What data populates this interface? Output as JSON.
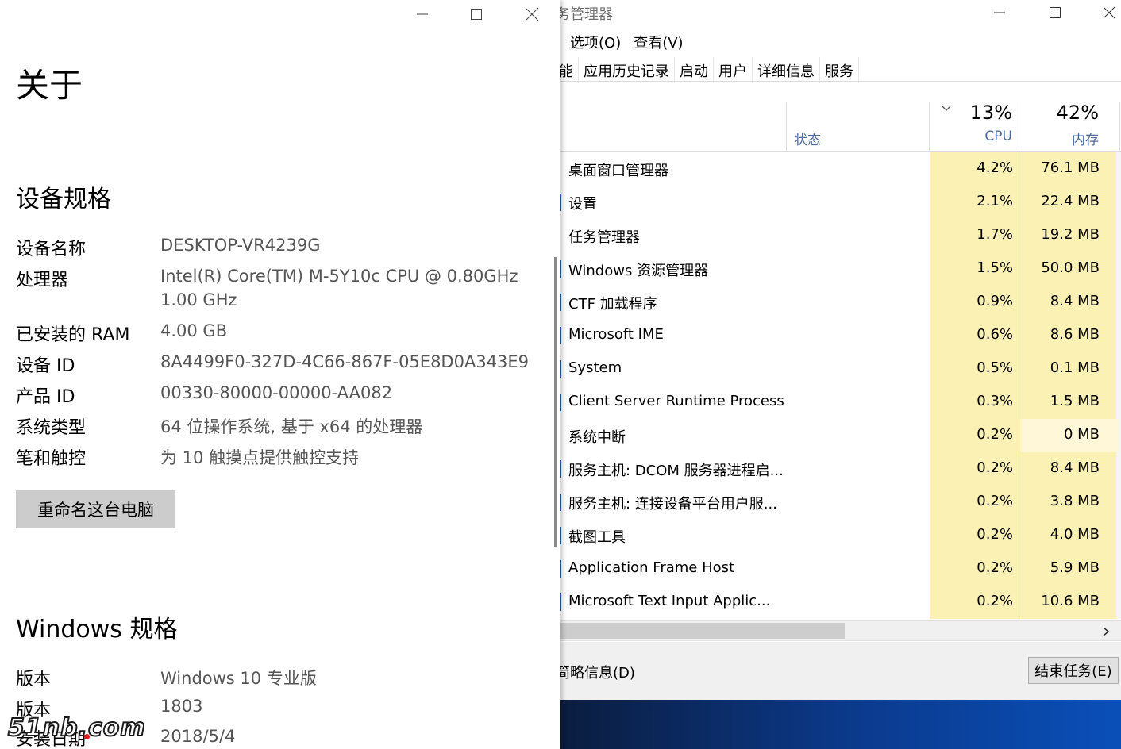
{
  "task_manager": {
    "title": "务管理器",
    "menu": [
      "选项(O)",
      "查看(V)"
    ],
    "tabs": [
      "性能",
      "应用历史记录",
      "启动",
      "用户",
      "详细信息",
      "服务"
    ],
    "columns": {
      "status": "状态",
      "cpu_pct": "13%",
      "cpu_label": "CPU",
      "mem_pct": "42%",
      "mem_label": "内存"
    },
    "processes": [
      {
        "name": "桌面窗口管理器",
        "cpu": "4.2%",
        "mem": "76.1 MB"
      },
      {
        "name": "设置",
        "cpu": "2.1%",
        "mem": "22.4 MB"
      },
      {
        "name": "任务管理器",
        "cpu": "1.7%",
        "mem": "19.2 MB"
      },
      {
        "name": "Windows 资源管理器",
        "cpu": "1.5%",
        "mem": "50.0 MB"
      },
      {
        "name": "CTF 加载程序",
        "cpu": "0.9%",
        "mem": "8.4 MB"
      },
      {
        "name": "Microsoft IME",
        "cpu": "0.6%",
        "mem": "8.6 MB"
      },
      {
        "name": "System",
        "cpu": "0.5%",
        "mem": "0.1 MB"
      },
      {
        "name": "Client Server Runtime Process",
        "cpu": "0.3%",
        "mem": "1.5 MB"
      },
      {
        "name": "系统中断",
        "cpu": "0.2%",
        "mem": "0 MB"
      },
      {
        "name": "服务主机: DCOM 服务器进程启...",
        "cpu": "0.2%",
        "mem": "8.4 MB"
      },
      {
        "name": "服务主机: 连接设备平台用户服...",
        "cpu": "0.2%",
        "mem": "3.8 MB"
      },
      {
        "name": "截图工具",
        "cpu": "0.2%",
        "mem": "4.0 MB"
      },
      {
        "name": "Application Frame Host",
        "cpu": "0.2%",
        "mem": "5.9 MB"
      },
      {
        "name": "Microsoft Text Input Applic...",
        "cpu": "0.2%",
        "mem": "10.6 MB"
      }
    ],
    "fewer_details": "简略信息(D)",
    "end_task": "结束任务(E)"
  },
  "about": {
    "page_title": "关于",
    "device_specs_heading": "设备规格",
    "device_specs": [
      {
        "label": "设备名称",
        "value": "DESKTOP-VR4239G"
      },
      {
        "label": "处理器",
        "value": "Intel(R) Core(TM) M-5Y10c CPU @ 0.80GHz",
        "value2": "1.00 GHz"
      },
      {
        "label": "已安装的 RAM",
        "value": "4.00 GB"
      },
      {
        "label": "设备 ID",
        "value": "8A4499F0-327D-4C66-867F-05E8D0A343E9"
      },
      {
        "label": "产品 ID",
        "value": "00330-80000-00000-AA082"
      },
      {
        "label": "系统类型",
        "value": "64 位操作系统, 基于 x64 的处理器"
      },
      {
        "label": "笔和触控",
        "value": "为 10 触摸点提供触控支持"
      }
    ],
    "rename_button": "重命名这台电脑",
    "windows_specs_heading": "Windows 规格",
    "windows_specs": [
      {
        "label": "版本",
        "value": "Windows 10 专业版"
      },
      {
        "label": "版本",
        "value": "1803"
      },
      {
        "label": "安装日期",
        "value": "2018/5/4"
      }
    ],
    "watermark": "51nb.com"
  },
  "icons": {
    "minimize": "minimize-icon",
    "maximize": "maximize-icon",
    "close": "close-icon",
    "sort": "chevron-down-icon",
    "scroll_right": "chevron-right-icon"
  }
}
